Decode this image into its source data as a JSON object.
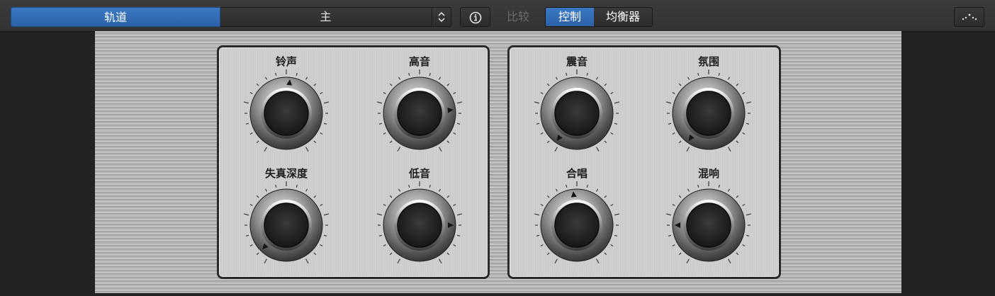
{
  "toolbar": {
    "track_label": "轨道",
    "preset_label": "主",
    "compare_label": "比较",
    "view_controls_label": "控制",
    "view_eq_label": "均衡器",
    "icons": {
      "stepper": "up-down-chevron-icon",
      "info": "info-icon",
      "link": "link-icon"
    }
  },
  "colors": {
    "accent": "#2f6cb5",
    "panel": "#cacaca",
    "toolbar": "#373737"
  },
  "knobs": [
    {
      "id": "knob-bell",
      "label": "铃声",
      "value": 0.52
    },
    {
      "id": "knob-treble",
      "label": "高音",
      "value": 0.78
    },
    {
      "id": "knob-distortion-depth",
      "label": "失真深度",
      "value": 0.05
    },
    {
      "id": "knob-bass",
      "label": "低音",
      "value": 0.8
    },
    {
      "id": "knob-tremolo",
      "label": "震音",
      "value": 0.02
    },
    {
      "id": "knob-ambience",
      "label": "氛围",
      "value": 0.02
    },
    {
      "id": "knob-chorus",
      "label": "合唱",
      "value": 0.48
    },
    {
      "id": "knob-reverb",
      "label": "混响",
      "value": 0.2
    }
  ]
}
